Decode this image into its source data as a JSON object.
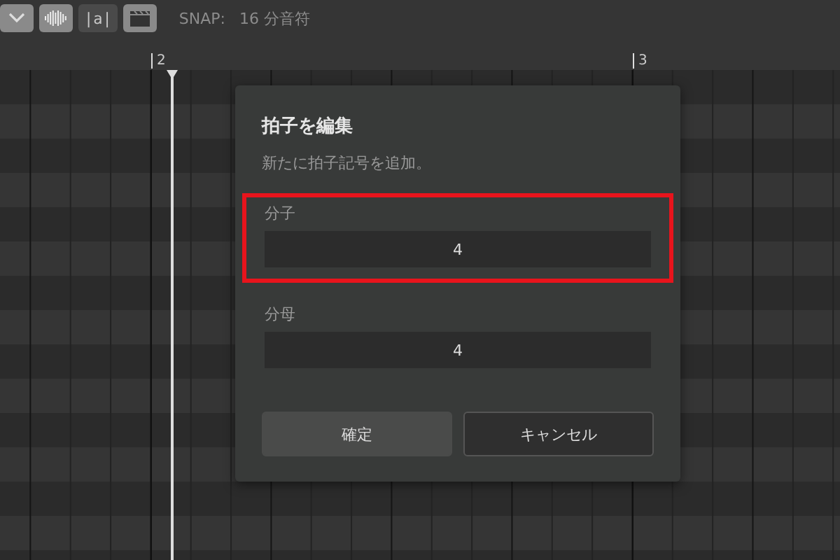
{
  "toolbar": {
    "tools": [
      {
        "kind": "chevron",
        "selected": true
      },
      {
        "kind": "waveform",
        "selected": true
      },
      {
        "kind": "text",
        "label": "|a|",
        "selected": false
      },
      {
        "kind": "clapperboard",
        "selected": true
      }
    ],
    "snap_label": "SNAP:",
    "snap_value": "16 分音符"
  },
  "ruler": {
    "markers": [
      "2",
      "3"
    ]
  },
  "dialog": {
    "title": "拍子を編集",
    "description": "新たに拍子記号を追加。",
    "fields": [
      {
        "label": "分子",
        "value": "4",
        "highlighted": true
      },
      {
        "label": "分母",
        "value": "4",
        "highlighted": false
      }
    ],
    "buttons": [
      {
        "label": "確定",
        "kind": "primary"
      },
      {
        "label": "キャンセル",
        "kind": "secondary"
      }
    ]
  }
}
